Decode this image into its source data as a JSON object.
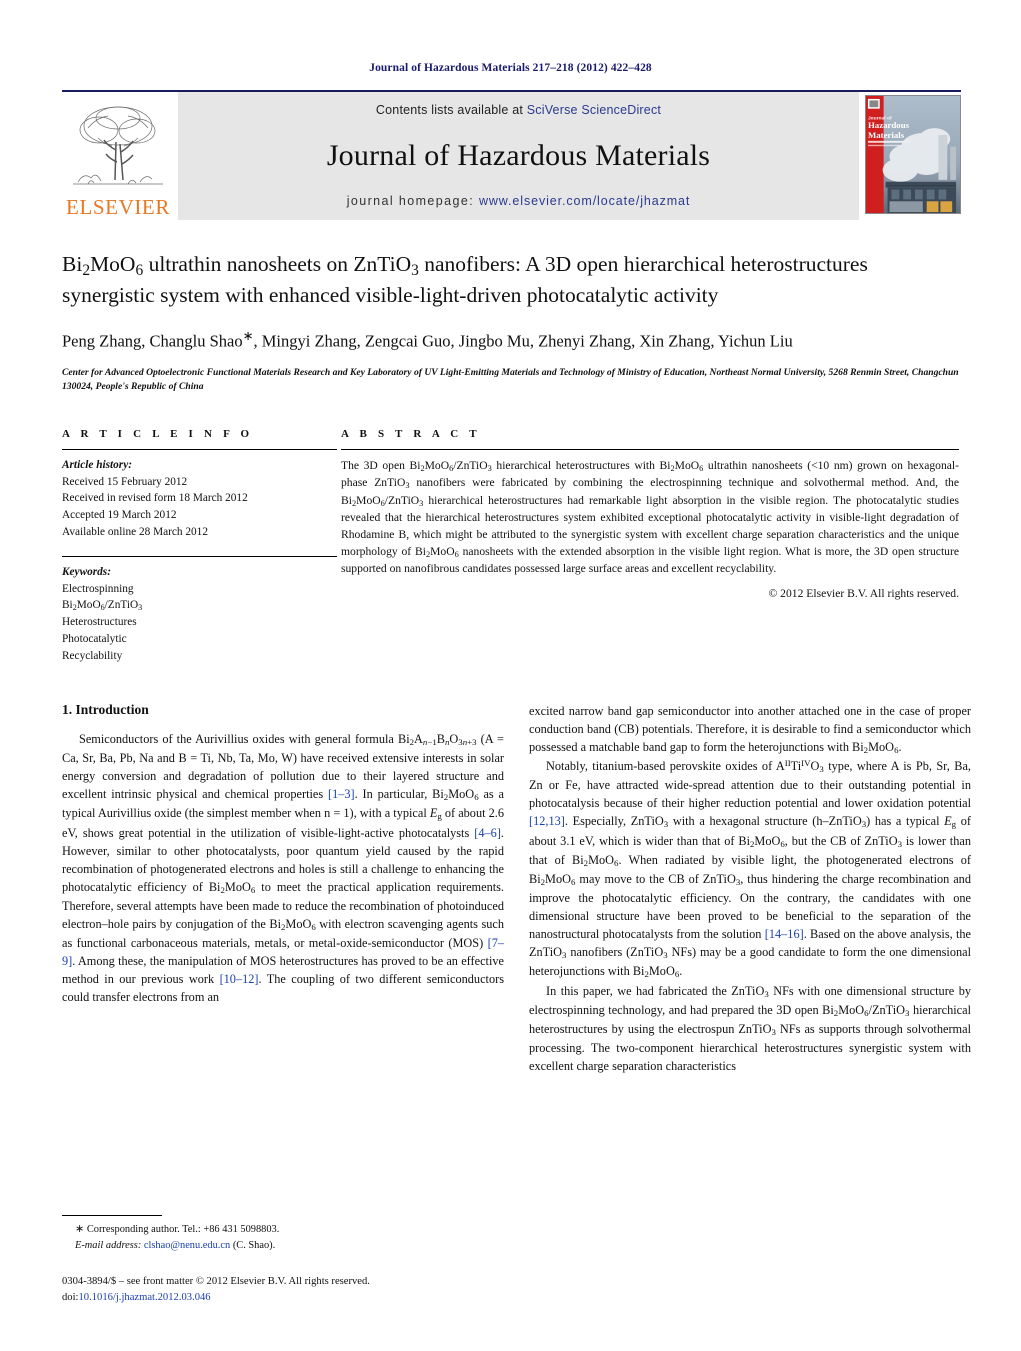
{
  "running_head": "Journal of Hazardous Materials 217–218 (2012) 422–428",
  "masthead": {
    "elsevier_wordmark": "ELSEVIER",
    "contents_prefix": "Contents lists available at ",
    "sciencedirect_link": "SciVerse ScienceDirect",
    "journal_title": "Journal of Hazardous Materials",
    "homepage_prefix": "journal homepage: ",
    "homepage_url": "www.elsevier.com/locate/jhazmat",
    "cover_title_line1": "Journal of",
    "cover_title_line2": "Hazardous",
    "cover_title_line3": "Materials"
  },
  "article": {
    "title_html": "Bi<sub>2</sub>MoO<sub>6</sub> ultrathin nanosheets on ZnTiO<sub>3</sub> nanofibers: A 3D open hierarchical heterostructures synergistic system with enhanced visible-light-driven photocatalytic activity",
    "authors_html": "Peng Zhang, Changlu Shao<span class=\"star\">∗</span>, Mingyi Zhang, Zengcai Guo, Jingbo Mu, Zhenyi Zhang, Xin Zhang, Yichun Liu",
    "affiliation": "Center for Advanced Optoelectronic Functional Materials Research and Key Laboratory of UV Light-Emitting Materials and Technology of Ministry of Education, Northeast Normal University, 5268 Renmin Street, Changchun 130024, People's Republic of China"
  },
  "article_info": {
    "heading": "A R T I C L E   I N F O",
    "history_label": "Article history:",
    "history": [
      "Received 15 February 2012",
      "Received in revised form 18 March 2012",
      "Accepted 19 March 2012",
      "Available online 28 March 2012"
    ],
    "keywords_label": "Keywords:",
    "keywords_html": [
      "Electrospinning",
      "Bi<sub>2</sub>MoO<sub>6</sub>/ZnTiO<sub>3</sub>",
      "Heterostructures",
      "Photocatalytic",
      "Recyclability"
    ]
  },
  "abstract": {
    "heading": "A B S T R A C T",
    "text_html": "The 3D open Bi<sub>2</sub>MoO<sub>6</sub>/ZnTiO<sub>3</sub> hierarchical heterostructures with Bi<sub>2</sub>MoO<sub>6</sub> ultrathin nanosheets (&lt;10 nm) grown on hexagonal-phase ZnTiO<sub>3</sub> nanofibers were fabricated by combining the electrospinning technique and solvothermal method. And, the Bi<sub>2</sub>MoO<sub>6</sub>/ZnTiO<sub>3</sub> hierarchical heterostructures had remarkable light absorption in the visible region. The photocatalytic studies revealed that the hierarchical heterostructures system exhibited exceptional photocatalytic activity in visible-light degradation of Rhodamine B, which might be attributed to the synergistic system with excellent charge separation characteristics and the unique morphology of Bi<sub>2</sub>MoO<sub>6</sub> nanosheets with the extended absorption in the visible light region. What is more, the 3D open structure supported on nanofibrous candidates possessed large surface areas and excellent recyclability.",
    "copyright": "© 2012 Elsevier B.V. All rights reserved."
  },
  "introduction": {
    "section_title": "1.  Introduction",
    "left_para_1_html": "Semiconductors of the Aurivillius oxides with general formula Bi<sub>2</sub>A<sub><i>n</i>−1</sub>B<sub><i>n</i></sub>O<sub>3<i>n</i>+3</sub> (A = Ca, Sr, Ba, Pb, Na and B = Ti, Nb, Ta, Mo, W) have received extensive interests in solar energy conversion and degradation of pollution due to their layered structure and excellent intrinsic physical and chemical properties <span class=\"ref\">[1–3]</span>. In particular, Bi<sub>2</sub>MoO<sub>6</sub> as a typical Aurivillius oxide (the simplest member when n = 1), with a typical <i>E</i><sub>g</sub> of about 2.6 eV, shows great potential in the utilization of visible-light-active photocatalysts <span class=\"ref\">[4–6]</span>. However, similar to other photocatalysts, poor quantum yield caused by the rapid recombination of photogenerated electrons and holes is still a challenge to enhancing the photocatalytic efficiency of Bi<sub>2</sub>MoO<sub>6</sub> to meet the practical application requirements. Therefore, several attempts have been made to reduce the recombination of photoinduced electron–hole pairs by conjugation of the Bi<sub>2</sub>MoO<sub>6</sub> with electron scavenging agents such as functional carbonaceous materials, metals, or metal-oxide-semiconductor (MOS) <span class=\"ref\">[7–9]</span>. Among these, the manipulation of MOS heterostructures has proved to be an effective method in our previous work <span class=\"ref\">[10–12]</span>. The coupling of two different semiconductors could transfer electrons from an",
    "right_para_1_html": "excited narrow band gap semiconductor into another attached one in the case of proper conduction band (CB) potentials. Therefore, it is desirable to find a semiconductor which possessed a matchable band gap to form the heterojunctions with Bi<sub>2</sub>MoO<sub>6</sub>.",
    "right_para_2_html": "Notably, titanium-based perovskite oxides of A<sup>II</sup>Ti<sup>IV</sup>O<sub>3</sub> type, where A is Pb, Sr, Ba, Zn or Fe, have attracted wide-spread attention due to their outstanding potential in photocatalysis because of their higher reduction potential and lower oxidation potential <span class=\"ref\">[12,13]</span>. Especially, ZnTiO<sub>3</sub> with a hexagonal structure (h–ZnTiO<sub>3</sub>) has a typical <i>E</i><sub>g</sub> of about 3.1 eV, which is wider than that of Bi<sub>2</sub>MoO<sub>6</sub>, but the CB of ZnTiO<sub>3</sub> is lower than that of Bi<sub>2</sub>MoO<sub>6</sub>. When radiated by visible light, the photogenerated electrons of Bi<sub>2</sub>MoO<sub>6</sub> may move to the CB of ZnTiO<sub>3</sub>, thus hindering the charge recombination and improve the photocatalytic efficiency. On the contrary, the candidates with one dimensional structure have been proved to be beneficial to the separation of the nanostructural photocatalysts from the solution <span class=\"ref\">[14–16]</span>. Based on the above analysis, the ZnTiO<sub>3</sub> nanofibers (ZnTiO<sub>3</sub> NFs) may be a good candidate to form the one dimensional heterojunctions with Bi<sub>2</sub>MoO<sub>6</sub>.",
    "right_para_3_html": "In this paper, we had fabricated the ZnTiO<sub>3</sub> NFs with one dimensional structure by electrospinning technology, and had prepared the 3D open Bi<sub>2</sub>MoO<sub>6</sub>/ZnTiO<sub>3</sub> hierarchical heterostructures by using the electrospun ZnTiO<sub>3</sub> NFs as supports through solvothermal processing. The two-component hierarchical heterostructures synergistic system with excellent charge separation characteristics"
  },
  "footnote": {
    "corresponding_html": "<span style=\"font-size:11px\">∗</span> Corresponding author. Tel.: +86 431 5098803.",
    "email_label": "E-mail address:",
    "email": "clshao@nenu.edu.cn",
    "email_suffix": " (C. Shao).",
    "issn_line": "0304-3894/$ – see front matter © 2012 Elsevier B.V. All rights reserved.",
    "doi_label": "doi:",
    "doi_value": "10.1016/j.jhazmat.2012.03.046"
  },
  "colors": {
    "link_blue": "#1a3faa",
    "header_navy": "#1a1a6e",
    "elsevier_orange": "#E87722",
    "banner_gray": "#e6e6e6"
  }
}
